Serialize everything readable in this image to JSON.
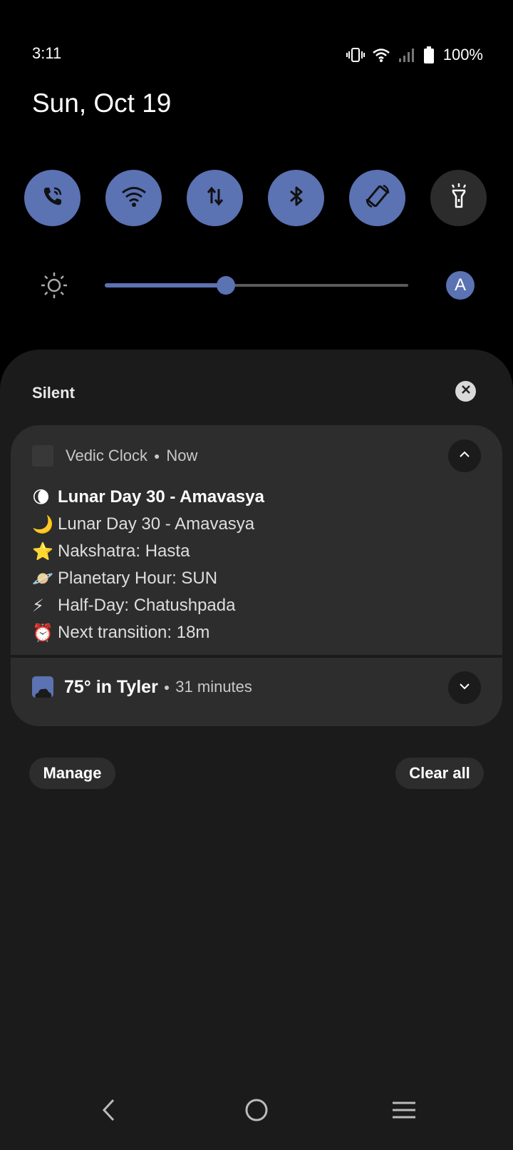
{
  "status_bar": {
    "time": "3:11",
    "battery_percent": "100%",
    "icons": [
      "vibrate-icon",
      "wifi-icon",
      "signal-icon",
      "battery-icon"
    ]
  },
  "date": "Sun, Oct 19",
  "quick_settings": [
    {
      "name": "wifi-calling",
      "icon": "phone-wifi-icon",
      "active": true
    },
    {
      "name": "wifi",
      "icon": "wifi-icon",
      "active": true
    },
    {
      "name": "mobile-data",
      "icon": "data-arrows-icon",
      "active": true
    },
    {
      "name": "bluetooth",
      "icon": "bluetooth-icon",
      "active": true
    },
    {
      "name": "auto-rotate",
      "icon": "rotate-icon",
      "active": true
    },
    {
      "name": "flashlight",
      "icon": "flashlight-icon",
      "active": false
    }
  ],
  "brightness": {
    "level": 0.4,
    "auto_label": "A"
  },
  "notifications": {
    "section_label": "Silent",
    "vedic": {
      "app_name": "Vedic Clock",
      "time": "Now",
      "lines": [
        {
          "emoji": "🌘",
          "text": "Lunar Day 30 - Amavasya"
        },
        {
          "emoji": "🌙",
          "text": "Lunar Day 30 - Amavasya"
        },
        {
          "emoji": "⭐",
          "text": "Nakshatra: Hasta"
        },
        {
          "emoji": "🪐",
          "text": "Planetary Hour: SUN"
        },
        {
          "emoji": "⚡",
          "text": "Half-Day: Chatushpada"
        },
        {
          "emoji": "⏰",
          "text": "Next transition: 18m"
        }
      ]
    },
    "weather": {
      "title": "75° in Tyler",
      "time": "31 minutes"
    },
    "manage_label": "Manage",
    "clear_all_label": "Clear all"
  },
  "colors": {
    "accent": "#5b72b3",
    "panel": "#1b1b1b",
    "card": "#2d2d2d"
  }
}
